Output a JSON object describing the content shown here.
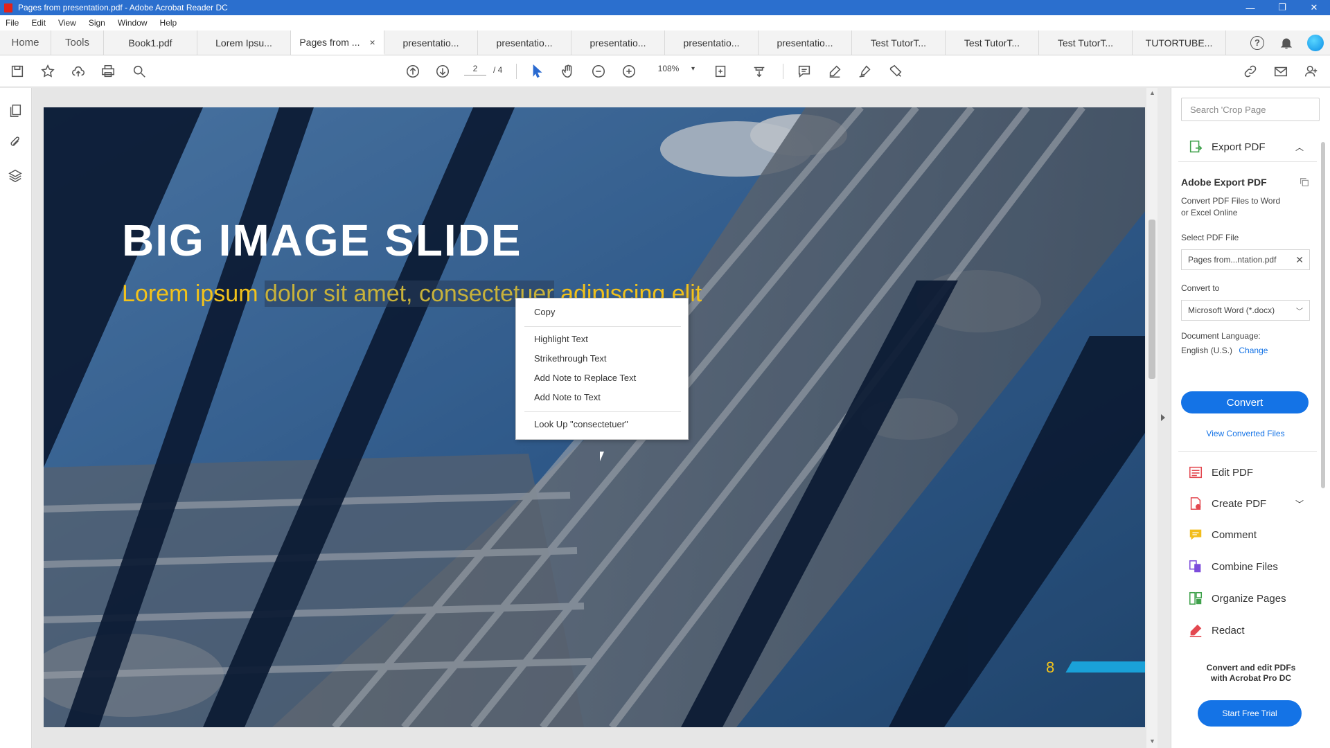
{
  "window": {
    "title": "Pages from presentation.pdf - Adobe Acrobat Reader DC",
    "minimize": "—",
    "restore": "❐",
    "close": "✕"
  },
  "menu": [
    "File",
    "Edit",
    "View",
    "Sign",
    "Window",
    "Help"
  ],
  "tabs": {
    "home": "Home",
    "tools": "Tools",
    "documents": [
      "Book1.pdf",
      "Lorem Ipsu...",
      "Pages from ...",
      "presentatio...",
      "presentatio...",
      "presentatio...",
      "presentatio...",
      "presentatio...",
      "Test TutorT...",
      "Test TutorT...",
      "Test TutorT...",
      "TUTORTUBE..."
    ],
    "close_glyph": "×",
    "help_glyph": "?"
  },
  "toolbar": {
    "current_page": "2",
    "page_separator": "/ 4",
    "zoom": "108%",
    "zoom_dropdown": "▾"
  },
  "slide": {
    "title": "BIG IMAGE SLIDE",
    "subtitle_before": "Lorem ipsum ",
    "subtitle_selected": "dolor sit amet, consectetuer",
    "subtitle_after": " adipiscing elit",
    "page_number": "8"
  },
  "context_menu": {
    "copy": "Copy",
    "highlight": "Highlight Text",
    "strikethrough": "Strikethrough Text",
    "add_note_replace": "Add Note to Replace Text",
    "add_note": "Add Note to Text",
    "lookup": "Look Up \"consectetuer\""
  },
  "right_panel": {
    "search_placeholder": "Search 'Crop Page",
    "export_pdf": "Export PDF",
    "adobe_export_title": "Adobe Export PDF",
    "adobe_export_desc_1": "Convert PDF Files to Word",
    "adobe_export_desc_2": "or Excel Online",
    "select_file_label": "Select PDF File",
    "selected_file": "Pages from...ntation.pdf",
    "convert_to_label": "Convert to",
    "convert_to_value": "Microsoft Word (*.docx)",
    "doc_language_label": "Document Language:",
    "doc_language_value": "English (U.S.)",
    "change_link": "Change",
    "convert_button": "Convert",
    "view_converted": "View Converted Files",
    "tools": [
      {
        "label": "Edit PDF",
        "color": "#e34850"
      },
      {
        "label": "Create PDF",
        "color": "#e34850"
      },
      {
        "label": "Comment",
        "color": "#f2bd1b"
      },
      {
        "label": "Combine Files",
        "color": "#7d4cdb"
      },
      {
        "label": "Organize Pages",
        "color": "#3fa14b"
      },
      {
        "label": "Redact",
        "color": "#e34850"
      }
    ],
    "promo_line1": "Convert and edit PDFs",
    "promo_line2": "with Acrobat Pro DC",
    "trial_button": "Start Free Trial"
  },
  "colors": {
    "titlebar": "#2b6fce",
    "accent": "#1473e6",
    "slide_title": "#ffffff",
    "slide_subtitle": "#f2c21b",
    "slide_bar": "#1aa1d8"
  }
}
